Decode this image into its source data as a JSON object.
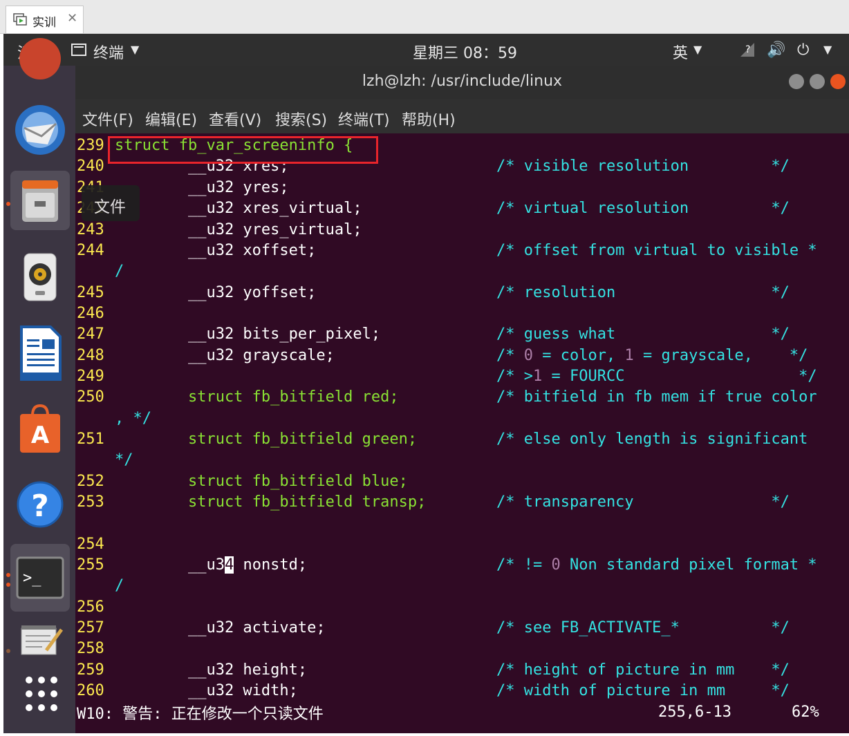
{
  "vm_tab": {
    "label": "实训",
    "close_glyph": "✕"
  },
  "topbar": {
    "activities": "活动",
    "app_menu": "终端",
    "clock": "星期三 08：59",
    "input_method": "英"
  },
  "dock": {
    "tooltip": "文件",
    "items": [
      "ubuntu-icon",
      "thunderbird-icon",
      "files-icon",
      "rhythmbox-icon",
      "libreoffice-writer-icon",
      "software-center-icon",
      "help-icon",
      "terminal-icon",
      "text-editor-icon",
      "show-apps-icon"
    ]
  },
  "terminal": {
    "title": "lzh@lzh: /usr/include/linux",
    "menu": [
      "文件(F)",
      "编辑(E)",
      "查看(V)",
      "搜索(S)",
      "终端(T)",
      "帮助(H)"
    ],
    "lines": {
      "l239": {
        "num": "239",
        "code": "struct fb_var_screeninfo {"
      },
      "l240": {
        "num": "240",
        "code": "        __u32 xres;",
        "comment": "/* visible resolution         */"
      },
      "l241": {
        "num": "241",
        "code": "        __u32 yres;"
      },
      "l242": {
        "num": "242",
        "code": "        __u32 xres_virtual;",
        "comment": "/* virtual resolution         */"
      },
      "l243": {
        "num": "243",
        "code": "        __u32 yres_virtual;"
      },
      "l244": {
        "num": "244",
        "code": "        __u32 xoffset;",
        "comment": "/* offset from virtual to visible *",
        "cont": "/"
      },
      "l245": {
        "num": "245",
        "code": "        __u32 yoffset;",
        "comment": "/* resolution                 */"
      },
      "l246": {
        "num": "246"
      },
      "l247": {
        "num": "247",
        "code": "        __u32 bits_per_pixel;",
        "comment": "/* guess what                 */"
      },
      "l248": {
        "num": "248",
        "code": "        __u32 grayscale;",
        "comment_a": "/* ",
        "comment_n1": "0",
        "comment_b": " = color, ",
        "comment_n2": "1",
        "comment_c": " = grayscale,    */"
      },
      "l249": {
        "num": "249",
        "comment_a": "/* >",
        "comment_n1": "1",
        "comment_b": " = FOURCC                   */"
      },
      "l250": {
        "num": "250",
        "code": "        struct fb_bitfield red;",
        "comment": "/* bitfield in fb mem if true color",
        "cont": ", */"
      },
      "l251": {
        "num": "251",
        "code": "        struct fb_bitfield green;",
        "comment": "/* else only length is significant",
        "cont": "*/"
      },
      "l252": {
        "num": "252",
        "code": "        struct fb_bitfield blue;"
      },
      "l253": {
        "num": "253",
        "code": "        struct fb_bitfield transp;",
        "comment": "/* transparency               */"
      },
      "l254": {
        "num": "254"
      },
      "l255": {
        "num": "255",
        "code_a": "        __u3",
        "code_cursor": "4",
        "code_b": " nonstd;",
        "comment_a": "/* != ",
        "comment_n1": "0",
        "comment_b": " Non standard pixel format *",
        "cont": "/"
      },
      "l256": {
        "num": "256"
      },
      "l257": {
        "num": "257",
        "code": "        __u32 activate;",
        "comment": "/* see FB_ACTIVATE_*          */"
      },
      "l258": {
        "num": "258"
      },
      "l259": {
        "num": "259",
        "code": "        __u32 height;",
        "comment": "/* height of picture in mm    */"
      },
      "l260": {
        "num": "260",
        "code": "        __u32 width;",
        "comment": "/* width of picture in mm     */"
      }
    },
    "status": {
      "warning": "W10: 警告: 正在修改一个只读文件",
      "position": "255,6-13",
      "percent": "62%"
    }
  },
  "colors": {
    "terminal_bg": "#300a24",
    "line_number": "#fce94f",
    "comment": "#34e2e2",
    "keyword": "#8ae234",
    "number": "#ad7fa8",
    "annotation_box": "#e8242b"
  }
}
